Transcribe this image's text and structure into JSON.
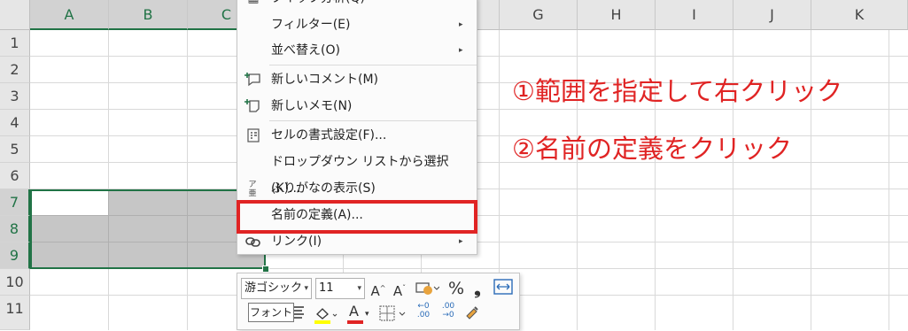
{
  "sheet": {
    "columns": [
      "A",
      "B",
      "C",
      "",
      "",
      "G",
      "H",
      "I",
      "J",
      "K"
    ],
    "rows": [
      "1",
      "2",
      "3",
      "4",
      "5",
      "6",
      "7",
      "8",
      "9",
      "10",
      "11"
    ]
  },
  "context_menu": {
    "items": [
      {
        "label": "クイック分析(Q)",
        "icon": "quick-analysis-icon"
      },
      {
        "label": "フィルター(E)",
        "submenu": true
      },
      {
        "label": "並べ替え(O)",
        "submenu": true
      },
      {
        "label": "新しいコメント(M)",
        "icon": "new-comment-icon"
      },
      {
        "label": "新しいメモ(N)",
        "icon": "new-note-icon"
      },
      {
        "label": "セルの書式設定(F)...",
        "icon": "format-cells-icon"
      },
      {
        "label": "ドロップダウン リストから選択(K)...",
        "icon": ""
      },
      {
        "label": "ふりがなの表示(S)",
        "icon": "furigana-icon",
        "icon_text": "ア亜"
      },
      {
        "label": "名前の定義(A)...",
        "icon": "",
        "highlighted": true
      },
      {
        "label": "リンク(I)",
        "icon": "link-icon",
        "submenu": true
      }
    ],
    "submenu_arrow": "▸"
  },
  "mini_toolbar": {
    "font_name": "游ゴシック",
    "font_size": "11",
    "grow_font": "A",
    "shrink_font": "A",
    "percent": "%",
    "comma": "❟",
    "tooltip": "フォント",
    "increase_decimal_top": "←0",
    "increase_decimal_bottom": ".00",
    "decrease_decimal_top": ".00",
    "decrease_decimal_bottom": "→0",
    "font_color_letter": "A"
  },
  "annotations": {
    "step1": "①範囲を指定して右クリック",
    "step2": "②名前の定義をクリック"
  },
  "colors": {
    "accent": "#217346",
    "highlight": "#e02424",
    "selection": "#c6c6c6"
  }
}
